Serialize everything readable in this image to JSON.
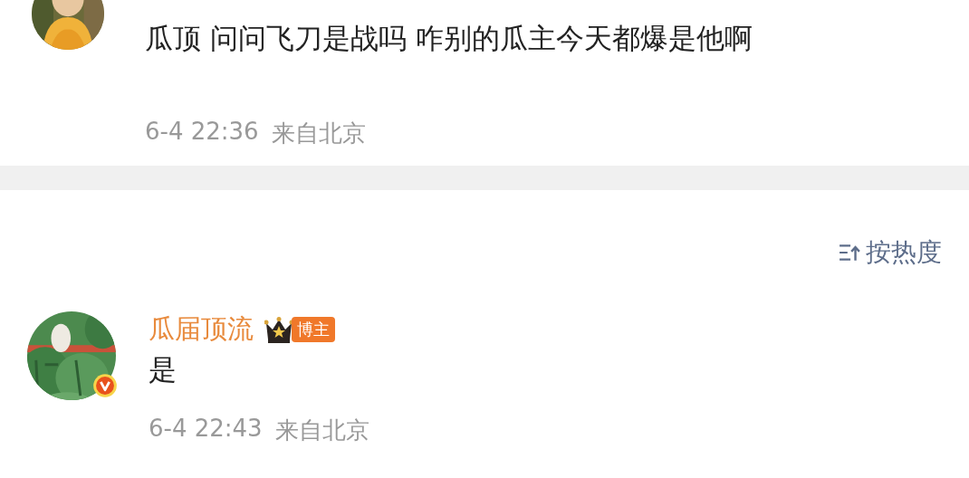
{
  "comments_top": [
    {
      "text": "瓜顶 问问飞刀是战吗 咋别的瓜主今天都爆是他啊",
      "time": "6-4 22:36",
      "location": "来自北京"
    }
  ],
  "sort": {
    "label": "按热度"
  },
  "comments": [
    {
      "author": "瓜届顶流",
      "badge": "博主",
      "verified": true,
      "text": "是",
      "time": "6-4 22:43",
      "location": "来自北京"
    }
  ]
}
